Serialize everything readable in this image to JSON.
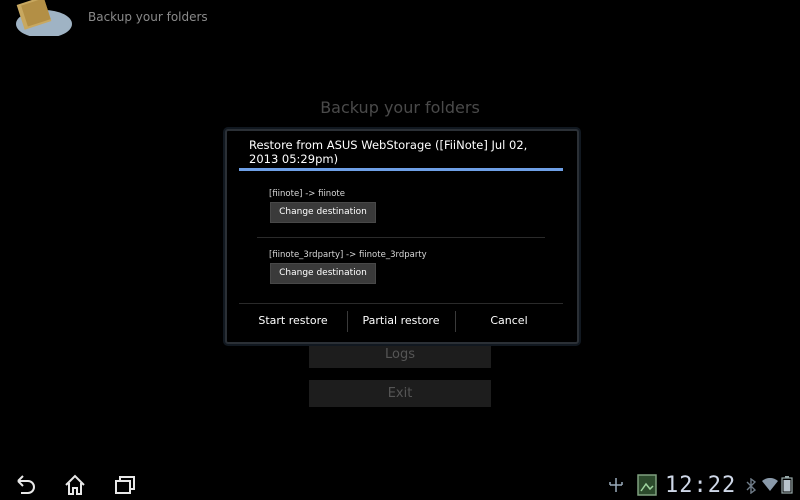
{
  "app": {
    "title": "Backup your folders",
    "icon": "cloud-folder-icon"
  },
  "screen": {
    "heading": "Backup your folders",
    "logs_label": "Logs",
    "exit_label": "Exit"
  },
  "dialog": {
    "title": "Restore from ASUS WebStorage ([FiiNote] Jul 02, 2013 05:29pm)",
    "entries": [
      {
        "mapping": "[fiinote] -> fiinote",
        "button": "Change destination"
      },
      {
        "mapping": "[fiinote_3rdparty] -> fiinote_3rdparty",
        "button": "Change destination"
      }
    ],
    "actions": {
      "start": "Start restore",
      "partial": "Partial restore",
      "cancel": "Cancel"
    }
  },
  "system_bar": {
    "time": "12:22",
    "icons": [
      "back-icon",
      "home-icon",
      "recent-apps-icon",
      "usb-icon",
      "gallery-icon",
      "bluetooth-icon",
      "wifi-icon",
      "battery-icon"
    ]
  },
  "colors": {
    "accent": "#6e9fe6",
    "background": "#000000"
  }
}
